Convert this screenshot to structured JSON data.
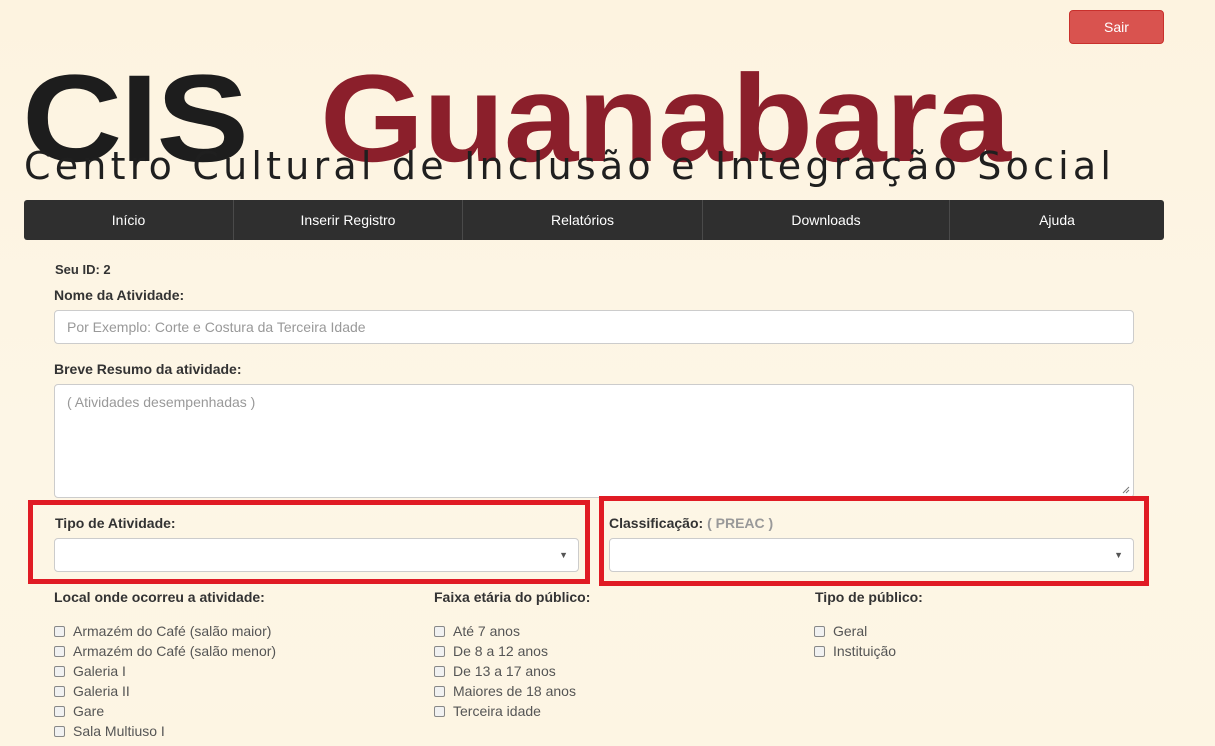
{
  "header": {
    "logout_label": "Sair",
    "logo": {
      "part1": "CIS",
      "part2": "Guanabara",
      "subtitle": "Centro Cultural de Inclusão e Integração Social"
    }
  },
  "nav": {
    "items": [
      {
        "label": "Início"
      },
      {
        "label": "Inserir Registro"
      },
      {
        "label": "Relatórios"
      },
      {
        "label": "Downloads"
      },
      {
        "label": "Ajuda"
      }
    ]
  },
  "form": {
    "user_id_text": "Seu ID: 2",
    "activity_name": {
      "label": "Nome da Atividade:",
      "value": "",
      "placeholder": "Por Exemplo: Corte e Costura da Terceira Idade"
    },
    "summary": {
      "label": "Breve Resumo da atividade:",
      "value": "",
      "placeholder": "( Atividades desempenhadas )"
    },
    "activity_type": {
      "label": "Tipo de Atividade:",
      "value": ""
    },
    "classification": {
      "label": "Classificação:",
      "hint": "( PREAC )",
      "value": ""
    },
    "location": {
      "label": "Local onde ocorreu a atividade:",
      "options": [
        {
          "label": "Armazém do Café (salão maior)",
          "checked": false
        },
        {
          "label": "Armazém do Café (salão menor)",
          "checked": false
        },
        {
          "label": "Galeria I",
          "checked": false
        },
        {
          "label": "Galeria II",
          "checked": false
        },
        {
          "label": "Gare",
          "checked": false
        },
        {
          "label": "Sala Multiuso I",
          "checked": false
        }
      ]
    },
    "age_range": {
      "label": "Faixa etária do público:",
      "options": [
        {
          "label": "Até 7 anos",
          "checked": false
        },
        {
          "label": "De 8 a 12 anos",
          "checked": false
        },
        {
          "label": "De 13 a 17 anos",
          "checked": false
        },
        {
          "label": "Maiores de 18 anos",
          "checked": false
        },
        {
          "label": "Terceira idade",
          "checked": false
        }
      ]
    },
    "audience_type": {
      "label": "Tipo de público:",
      "options": [
        {
          "label": "Geral",
          "checked": false
        },
        {
          "label": "Instituição",
          "checked": false
        }
      ]
    }
  },
  "colors": {
    "background": "#fdf4e2",
    "nav": "#2f2f2f",
    "logout": "#d9534f",
    "brand_dark": "#1d1d1d",
    "brand_red": "#8b1f2b",
    "highlight": "#e01b24"
  }
}
